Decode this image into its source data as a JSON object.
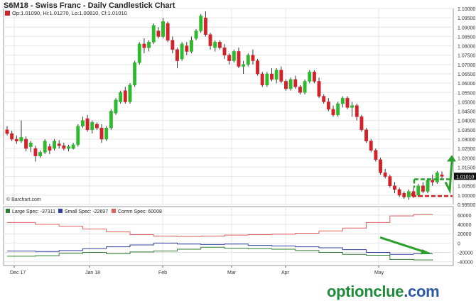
{
  "title": "S6M18 - Swiss Franc - Daily Candlestick Chart",
  "ohlc_legend": "Op:1.01090, Hi:1.01270, Lo:1.00810, Cl:1.01010",
  "credit": "© Barchart.com",
  "last_price_label": "1.01010",
  "watermark": {
    "name": "optionclue",
    "domain": ".com"
  },
  "colors": {
    "up": "#2fb92f",
    "down": "#d2232a",
    "large_spec": "#2e7d32",
    "small_spec": "#3040a0",
    "comm_spec": "#e06060",
    "arrow": "#2aa02a",
    "box_green": "#2aa02a",
    "box_red": "#d22020"
  },
  "chart_data": [
    {
      "type": "candlestick",
      "title": "S6M18 - Swiss Franc - Daily Candlestick Chart",
      "ylim": [
        0.995,
        1.1
      ],
      "y_ticks": [
        "1.10000",
        "1.09500",
        "1.09000",
        "1.08500",
        "1.08000",
        "1.07500",
        "1.07000",
        "1.06500",
        "1.06000",
        "1.05500",
        "1.05000",
        "1.04500",
        "1.04000",
        "1.03500",
        "1.03000",
        "1.02500",
        "1.02000",
        "1.01500",
        "1.01000",
        "1.00500",
        "1.00000",
        "0.99500"
      ],
      "x_ticks": [
        "Dec 17",
        "Jan 18",
        "Feb",
        "Mar",
        "Apr",
        "May"
      ],
      "candles": [
        [
          1.035,
          1.037,
          1.032,
          1.033
        ],
        [
          1.033,
          1.0345,
          1.029,
          1.03
        ],
        [
          1.03,
          1.032,
          1.0275,
          1.029
        ],
        [
          1.029,
          1.04,
          1.028,
          1.031
        ],
        [
          1.03,
          1.0315,
          1.0235,
          1.025
        ],
        [
          1.026,
          1.029,
          1.023,
          1.028
        ],
        [
          1.025,
          1.0265,
          1.018,
          1.021
        ],
        [
          1.021,
          1.024,
          1.02,
          1.023
        ],
        [
          1.023,
          1.03,
          1.022,
          1.029
        ],
        [
          1.026,
          1.0275,
          1.022,
          1.024
        ],
        [
          1.025,
          1.03,
          1.024,
          1.029
        ],
        [
          1.0275,
          1.0295,
          1.025,
          1.0265
        ],
        [
          1.0265,
          1.028,
          1.024,
          1.025
        ],
        [
          1.025,
          1.027,
          1.0235,
          1.026
        ],
        [
          1.025,
          1.028,
          1.0245,
          1.027
        ],
        [
          1.027,
          1.038,
          1.026,
          1.037
        ],
        [
          1.037,
          1.042,
          1.036,
          1.04
        ],
        [
          1.041,
          1.043,
          1.034,
          1.035
        ],
        [
          1.035,
          1.04,
          1.033,
          1.039
        ],
        [
          1.038,
          1.039,
          1.035,
          1.036
        ],
        [
          1.036,
          1.038,
          1.028,
          1.03
        ],
        [
          1.03,
          1.037,
          1.029,
          1.036
        ],
        [
          1.036,
          1.046,
          1.035,
          1.045
        ],
        [
          1.044,
          1.052,
          1.043,
          1.051
        ],
        [
          1.05,
          1.056,
          1.049,
          1.055
        ],
        [
          1.056,
          1.058,
          1.049,
          1.05
        ],
        [
          1.05,
          1.06,
          1.049,
          1.059
        ],
        [
          1.059,
          1.072,
          1.058,
          1.071
        ],
        [
          1.071,
          1.082,
          1.07,
          1.081
        ],
        [
          1.081,
          1.084,
          1.076,
          1.079
        ],
        [
          1.079,
          1.083,
          1.077,
          1.082
        ],
        [
          1.082,
          1.092,
          1.081,
          1.091
        ],
        [
          1.088,
          1.09,
          1.084,
          1.085
        ],
        [
          1.085,
          1.095,
          1.084,
          1.093
        ],
        [
          1.092,
          1.093,
          1.082,
          1.083
        ],
        [
          1.083,
          1.085,
          1.076,
          1.078
        ],
        [
          1.078,
          1.079,
          1.068,
          1.072
        ],
        [
          1.073,
          1.082,
          1.072,
          1.081
        ],
        [
          1.08,
          1.082,
          1.075,
          1.077
        ],
        [
          1.077,
          1.085,
          1.076,
          1.083
        ],
        [
          1.084,
          1.089,
          1.083,
          1.088
        ],
        [
          1.088,
          1.097,
          1.087,
          1.096
        ],
        [
          1.095,
          1.0985,
          1.085,
          1.086
        ],
        [
          1.086,
          1.087,
          1.078,
          1.08
        ],
        [
          1.079,
          1.083,
          1.077,
          1.082
        ],
        [
          1.082,
          1.083,
          1.078,
          1.079
        ],
        [
          1.079,
          1.081,
          1.073,
          1.075
        ],
        [
          1.075,
          1.076,
          1.07,
          1.072
        ],
        [
          1.072,
          1.078,
          1.071,
          1.077
        ],
        [
          1.077,
          1.079,
          1.068,
          1.069
        ],
        [
          1.069,
          1.072,
          1.065,
          1.07
        ],
        [
          1.07,
          1.076,
          1.069,
          1.075
        ],
        [
          1.075,
          1.078,
          1.07,
          1.072
        ],
        [
          1.072,
          1.073,
          1.064,
          1.065
        ],
        [
          1.065,
          1.066,
          1.058,
          1.059
        ],
        [
          1.059,
          1.066,
          1.058,
          1.065
        ],
        [
          1.065,
          1.068,
          1.061,
          1.062
        ],
        [
          1.062,
          1.068,
          1.06,
          1.067
        ],
        [
          1.067,
          1.069,
          1.06,
          1.061
        ],
        [
          1.061,
          1.062,
          1.056,
          1.057
        ],
        [
          1.057,
          1.063,
          1.056,
          1.062
        ],
        [
          1.062,
          1.064,
          1.057,
          1.058
        ],
        [
          1.058,
          1.059,
          1.054,
          1.055
        ],
        [
          1.055,
          1.062,
          1.054,
          1.061
        ],
        [
          1.061,
          1.067,
          1.06,
          1.066
        ],
        [
          1.066,
          1.067,
          1.06,
          1.061
        ],
        [
          1.061,
          1.063,
          1.052,
          1.053
        ],
        [
          1.053,
          1.054,
          1.049,
          1.05
        ],
        [
          1.05,
          1.052,
          1.045,
          1.046
        ],
        [
          1.046,
          1.048,
          1.042,
          1.043
        ],
        [
          1.043,
          1.05,
          1.042,
          1.049
        ],
        [
          1.049,
          1.053,
          1.047,
          1.052
        ],
        [
          1.052,
          1.053,
          1.046,
          1.047
        ],
        [
          1.047,
          1.05,
          1.042,
          1.048
        ],
        [
          1.048,
          1.049,
          1.04,
          1.042
        ],
        [
          1.042,
          1.043,
          1.034,
          1.035
        ],
        [
          1.035,
          1.036,
          1.028,
          1.029
        ],
        [
          1.029,
          1.03,
          1.023,
          1.024
        ],
        [
          1.024,
          1.025,
          1.018,
          1.019
        ],
        [
          1.019,
          1.02,
          1.011,
          1.012
        ],
        [
          1.012,
          1.014,
          1.009,
          1.01
        ],
        [
          1.01,
          1.011,
          1.004,
          1.005
        ],
        [
          1.005,
          1.007,
          1.001,
          1.003
        ],
        [
          1.003,
          1.004,
          0.999,
          1.0
        ],
        [
          1.001,
          1.002,
          0.998,
          0.999
        ],
        [
          0.999,
          1.003,
          0.9975,
          1.002
        ],
        [
          1.002,
          1.004,
          0.9985,
          1.0
        ],
        [
          1.0,
          1.006,
          0.999,
          1.005
        ],
        [
          1.005,
          1.007,
          1.001,
          1.002
        ],
        [
          1.002,
          1.009,
          1.001,
          1.008
        ],
        [
          1.008,
          1.011,
          1.005,
          1.007
        ],
        [
          1.007,
          1.013,
          1.006,
          1.012
        ],
        [
          1.0109,
          1.0127,
          1.0081,
          1.0101
        ]
      ]
    },
    {
      "type": "line",
      "title": "",
      "ylim": [
        -48000,
        78000
      ],
      "y_ticks": [
        60000,
        40000,
        20000,
        0,
        -20000,
        -40000
      ],
      "legend": [
        "Large Spec: -37311",
        "Small Spec: -22697",
        "Comm Spec: 60008"
      ],
      "series": [
        {
          "name": "Comm Spec",
          "values": [
            44000,
            44000,
            44000,
            44000,
            44000,
            44000,
            40000,
            40000,
            40000,
            40000,
            40000,
            36000,
            36000,
            36000,
            36000,
            36000,
            30000,
            30000,
            30000,
            30000,
            30000,
            24000,
            24000,
            24000,
            24000,
            24000,
            18000,
            18000,
            18000,
            18000,
            18000,
            15000,
            15000,
            15000,
            15000,
            15000,
            14000,
            14000,
            14000,
            14000,
            14000,
            15000,
            15000,
            15000,
            15000,
            15000,
            17000,
            17000,
            17000,
            17000,
            17000,
            18000,
            18000,
            18000,
            18000,
            18000,
            19000,
            19000,
            19000,
            19000,
            19000,
            21000,
            21000,
            21000,
            21000,
            21000,
            26000,
            26000,
            26000,
            26000,
            26000,
            32000,
            32000,
            32000,
            32000,
            32000,
            44000,
            44000,
            44000,
            44000,
            44000,
            58000,
            58000,
            58000,
            58000,
            58000,
            61000,
            61000,
            61000,
            61000,
            60008
          ]
        },
        {
          "name": "Small Spec",
          "values": [
            -17000,
            -17000,
            -17000,
            -17000,
            -17000,
            -17000,
            -18000,
            -18000,
            -18000,
            -18000,
            -18000,
            -16000,
            -16000,
            -16000,
            -16000,
            -16000,
            -12000,
            -12000,
            -12000,
            -12000,
            -12000,
            -8000,
            -8000,
            -8000,
            -8000,
            -8000,
            -4000,
            -4000,
            -4000,
            -4000,
            -4000,
            0,
            0,
            0,
            0,
            0,
            -2000,
            -2000,
            -2000,
            -2000,
            -2000,
            -3000,
            -3000,
            -3000,
            -3000,
            -3000,
            -2000,
            -2000,
            -2000,
            -2000,
            -2000,
            -5000,
            -5000,
            -5000,
            -5000,
            -5000,
            -6000,
            -6000,
            -6000,
            -6000,
            -6000,
            -8000,
            -8000,
            -8000,
            -8000,
            -8000,
            -10000,
            -10000,
            -10000,
            -10000,
            -10000,
            -14000,
            -14000,
            -14000,
            -14000,
            -14000,
            -20000,
            -20000,
            -20000,
            -20000,
            -20000,
            -24000,
            -24000,
            -24000,
            -24000,
            -24000,
            -23000,
            -23000,
            -23000,
            -23000,
            -22697
          ]
        },
        {
          "name": "Large Spec",
          "values": [
            -28000,
            -28000,
            -28000,
            -28000,
            -28000,
            -28000,
            -27000,
            -27000,
            -27000,
            -27000,
            -27000,
            -22000,
            -22000,
            -22000,
            -22000,
            -22000,
            -20000,
            -20000,
            -20000,
            -20000,
            -20000,
            -23000,
            -23000,
            -23000,
            -23000,
            -23000,
            -19000,
            -19000,
            -19000,
            -19000,
            -19000,
            -17000,
            -17000,
            -17000,
            -17000,
            -17000,
            -13000,
            -13000,
            -13000,
            -13000,
            -13000,
            -9000,
            -9000,
            -9000,
            -9000,
            -9000,
            -11000,
            -11000,
            -11000,
            -11000,
            -11000,
            -12000,
            -12000,
            -12000,
            -12000,
            -12000,
            -13000,
            -13000,
            -13000,
            -13000,
            -13000,
            -16000,
            -16000,
            -16000,
            -16000,
            -16000,
            -20000,
            -20000,
            -20000,
            -20000,
            -20000,
            -24000,
            -24000,
            -24000,
            -24000,
            -24000,
            -26000,
            -26000,
            -26000,
            -26000,
            -26000,
            -35000,
            -35000,
            -35000,
            -35000,
            -35000,
            -36000,
            -36000,
            -36000,
            -36000,
            -37311
          ]
        }
      ]
    }
  ]
}
